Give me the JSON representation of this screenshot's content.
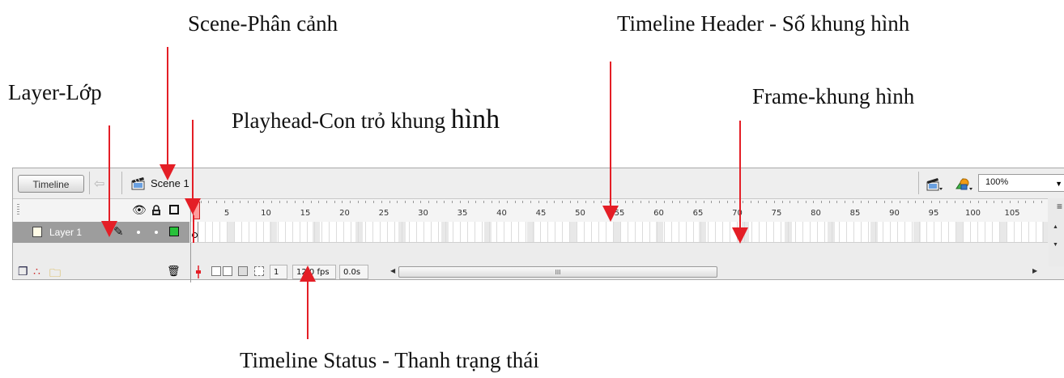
{
  "callouts": {
    "scene": "Scene-Phân cảnh",
    "timeline_header": "Timeline Header - Số khung hình",
    "layer": "Layer-Lớp",
    "playhead_prefix": "Playhead-Con trỏ khung ",
    "playhead_suffix": "hình",
    "frame": "Frame-khung hình",
    "status": "Timeline Status - Thanh trạng thái"
  },
  "toolbar": {
    "timeline_button": "Timeline",
    "scene_name": "Scene 1",
    "zoom": "100%"
  },
  "ruler": {
    "labels": [
      "5",
      "10",
      "15",
      "20",
      "25",
      "30",
      "35",
      "40",
      "45",
      "50",
      "55",
      "60",
      "65",
      "70",
      "75",
      "80",
      "85",
      "90",
      "95",
      "100",
      "105",
      "1"
    ]
  },
  "layers": [
    {
      "name": "Layer 1"
    }
  ],
  "status": {
    "current_frame": "1",
    "frame_rate": "12.0 fps",
    "elapsed_time": "0.0s"
  },
  "colors": {
    "arrow": "#e41e26",
    "playhead": "#ff9c9c",
    "layer_selected": "#9d9d9d",
    "outline_color": "#27c13a"
  }
}
